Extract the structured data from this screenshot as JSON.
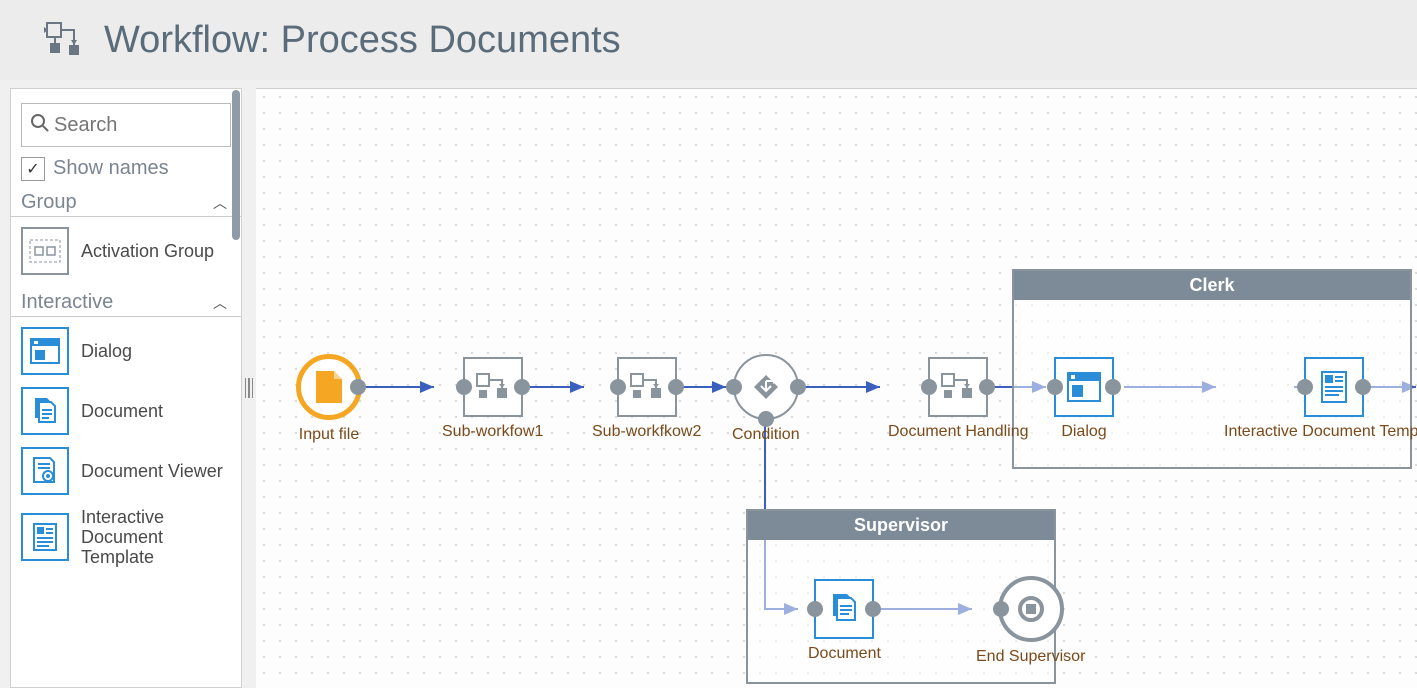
{
  "header": {
    "title": "Workflow: Process Documents"
  },
  "sidebar": {
    "search_placeholder": "Search",
    "show_names_label": "Show names",
    "sections": {
      "group": {
        "title": "Group",
        "items": [
          {
            "label": "Activation Group",
            "icon": "activation-group"
          }
        ]
      },
      "interactive": {
        "title": "Interactive",
        "items": [
          {
            "label": "Dialog",
            "icon": "dialog"
          },
          {
            "label": "Document",
            "icon": "document"
          },
          {
            "label": "Document Viewer",
            "icon": "document-viewer"
          },
          {
            "label": "Interactive Document Template",
            "icon": "interactive-doc-template"
          }
        ]
      }
    }
  },
  "canvas": {
    "nodes": {
      "input_file": "Input file",
      "sub1": "Sub-workfow1",
      "sub2": "Sub-workfkow2",
      "condition": "Condition",
      "doc_handling": "Document Handling",
      "dialog": "Dialog",
      "idt": "Interactive Document Template",
      "document": "Document",
      "end_supervisor": "End Supervisor"
    },
    "groups": {
      "clerk": "Clerk",
      "supervisor": "Supervisor"
    }
  }
}
